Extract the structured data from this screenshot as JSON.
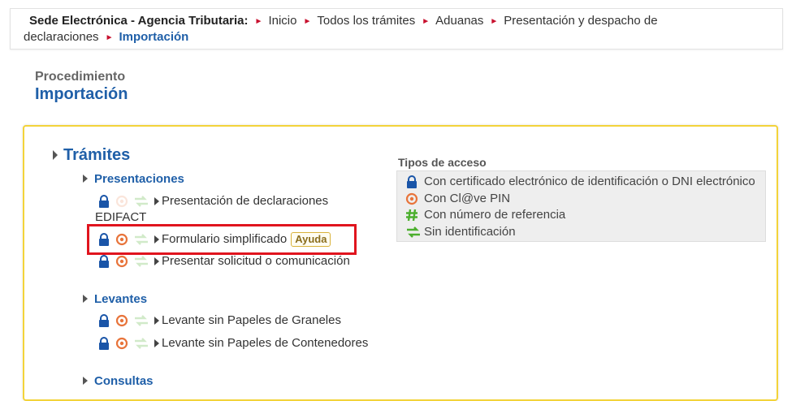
{
  "breadcrumb": {
    "site": "Sede Electrónica - Agencia Tributaria:",
    "items": [
      "Inicio",
      "Todos los trámites",
      "Aduanas",
      "Presentación y despacho de"
    ],
    "items_line2": "declaraciones",
    "current": "Importación"
  },
  "header": {
    "label": "Procedimiento",
    "title": "Importación"
  },
  "tramites": {
    "title": "Trámites",
    "groups": [
      {
        "name": "Presentaciones",
        "items": [
          {
            "label_line1": "Presentación de declaraciones",
            "label_line2": "EDIFACT"
          },
          {
            "label": "Formulario simplificado",
            "badge": "Ayuda"
          },
          {
            "label": "Presentar solicitud o comunicación"
          }
        ]
      },
      {
        "name": "Levantes",
        "items": [
          {
            "label": "Levante sin Papeles de Graneles"
          },
          {
            "label": "Levante sin Papeles de Contenedores"
          }
        ]
      },
      {
        "name": "Consultas",
        "items": []
      }
    ]
  },
  "access_types": {
    "title": "Tipos de acceso",
    "items": [
      {
        "icon": "lock-icon",
        "label": "Con certificado electrónico de identificación o DNI electrónico"
      },
      {
        "icon": "clave-icon",
        "label": "Con Cl@ve PIN"
      },
      {
        "icon": "hash-icon",
        "label": "Con número de referencia"
      },
      {
        "icon": "arrows-icon",
        "label": "Sin identificación"
      }
    ]
  },
  "colors": {
    "link_blue": "#1f5fa8",
    "panel_border": "#f3d33a",
    "highlight_red": "#e0141e",
    "lock_blue": "#1a55a8",
    "clave_orange": "#e8743b",
    "hash_green": "#4caf2e",
    "arrows_green": "#4caf2e"
  }
}
